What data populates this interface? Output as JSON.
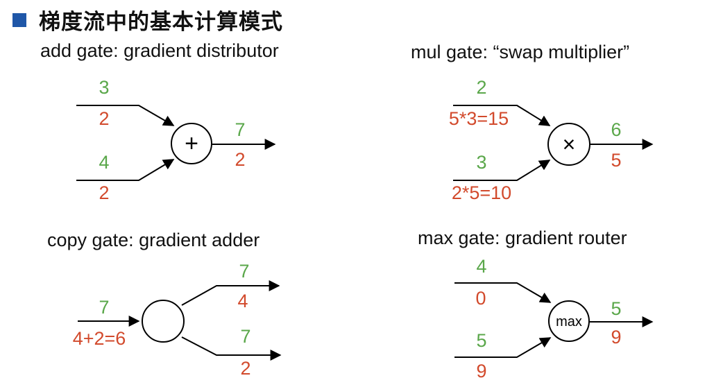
{
  "title": "梯度流中的基本计算模式",
  "colors": {
    "bullet": "#1f57a8",
    "forward_value": "#5aa74a",
    "gradient_value": "#d24a2c"
  },
  "add_gate": {
    "heading": "add gate: gradient distributor",
    "node_symbol": "+",
    "input1": {
      "value": "3",
      "grad": "2"
    },
    "input2": {
      "value": "4",
      "grad": "2"
    },
    "output": {
      "value": "7",
      "grad": "2"
    }
  },
  "mul_gate": {
    "heading": "mul gate: “swap multiplier”",
    "node_symbol": "×",
    "input1": {
      "value": "2",
      "grad": "5*3=15"
    },
    "input2": {
      "value": "3",
      "grad": "2*5=10"
    },
    "output": {
      "value": "6",
      "grad": "5"
    }
  },
  "copy_gate": {
    "heading": "copy gate: gradient adder",
    "input": {
      "value": "7",
      "grad": "4+2=6"
    },
    "output1": {
      "value": "7",
      "grad": "4"
    },
    "output2": {
      "value": "7",
      "grad": "2"
    }
  },
  "max_gate": {
    "heading": "max gate: gradient router",
    "node_symbol": "max",
    "input1": {
      "value": "4",
      "grad": "0"
    },
    "input2": {
      "value": "5",
      "grad": "9"
    },
    "output": {
      "value": "5",
      "grad": "9"
    }
  }
}
